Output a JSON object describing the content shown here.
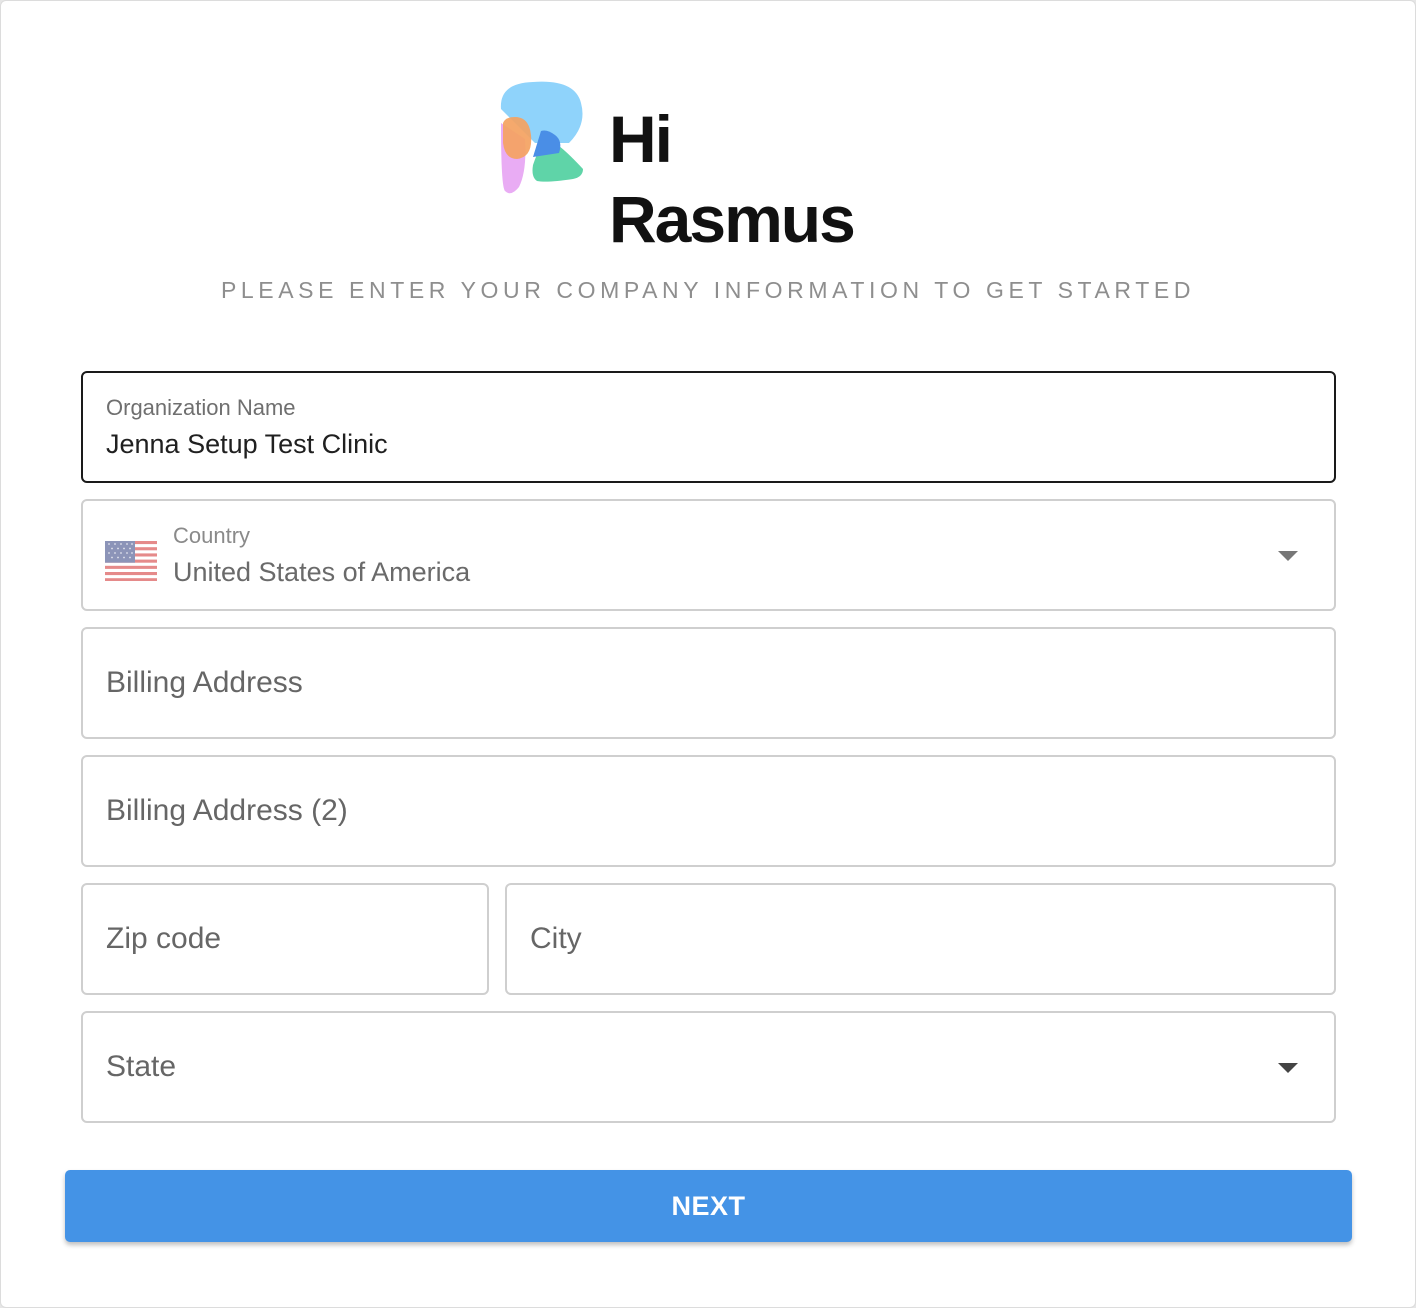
{
  "brand": {
    "name": "Hi Rasmus",
    "logo_icon": "hi-rasmus-logo-icon"
  },
  "subtitle": "PLEASE ENTER YOUR COMPANY INFORMATION TO GET STARTED",
  "form": {
    "organization": {
      "label": "Organization Name",
      "value": "Jenna Setup Test Clinic"
    },
    "country": {
      "label": "Country",
      "value": "United States of America",
      "flag_icon": "us-flag-icon"
    },
    "billing_address": {
      "placeholder": "Billing Address"
    },
    "billing_address_2": {
      "placeholder": "Billing Address (2)"
    },
    "zip": {
      "placeholder": "Zip code"
    },
    "city": {
      "placeholder": "City"
    },
    "state": {
      "placeholder": "State"
    }
  },
  "actions": {
    "next_label": "NEXT"
  },
  "colors": {
    "primary": "#4493e6",
    "focused_border": "#1a1a1a",
    "border": "#cfcfcf",
    "subtitle": "#8e8e8e"
  }
}
